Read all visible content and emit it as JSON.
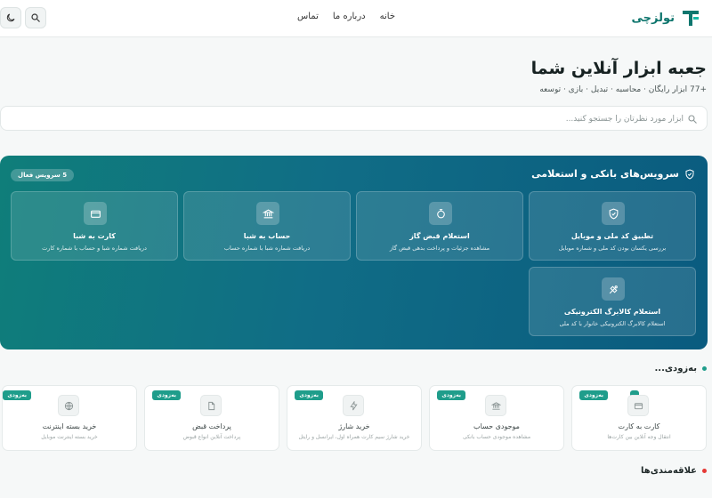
{
  "header": {
    "brand_name": "تولزچی",
    "nav": [
      "خانه",
      "درباره ما",
      "تماس"
    ]
  },
  "hero": {
    "title": "جعبه ابزار آنلاین شما",
    "subtitle": "+77 ابزار رایگان · محاسبه · تبدیل · بازی · توسعه",
    "search_placeholder": "ابزار مورد نظرتان را جستجو کنید..."
  },
  "bank": {
    "title": "سرویس‌های بانکی و استعلامی",
    "badge": "5 سرویس فعال",
    "services": [
      {
        "title": "تطبیق کد ملی و موبایل",
        "desc": "بررسی یکسان بودن کد ملی و شماره موبایل",
        "icon": "shield-check-icon"
      },
      {
        "title": "استعلام قبض گاز",
        "desc": "مشاهده جزئیات و پرداخت بدهی قبض گاز",
        "icon": "gas-flame-icon"
      },
      {
        "title": "حساب به شبا",
        "desc": "دریافت شماره شبا با شماره حساب",
        "icon": "bank-icon"
      },
      {
        "title": "کارت به شبا",
        "desc": "دریافت شماره شبا و حساب با شماره کارت",
        "icon": "credit-card-icon"
      },
      {
        "title": "استعلام کالابرگ الکترونیکی",
        "desc": "استعلام کالابرگ الکترونیکی خانوار با کد ملی",
        "icon": "tag-icon"
      }
    ]
  },
  "soon": {
    "title": "به‌زودی...",
    "badge": "به‌زودی",
    "items": [
      {
        "title": "کارت به کارت",
        "desc": "انتقال وجه آنلاین بین کارت‌ها",
        "icon": "card-icon"
      },
      {
        "title": "موجودی حساب",
        "desc": "مشاهده موجودی حساب بانکی",
        "icon": "bank-icon"
      },
      {
        "title": "خرید شارژ",
        "desc": "خرید شارژ سیم کارت همراه اول، ایرانسل و رایتل",
        "icon": "bolt-icon"
      },
      {
        "title": "پرداخت قبض",
        "desc": "پرداخت آنلاین انواع قبوض",
        "icon": "document-icon"
      },
      {
        "title": "خرید بسته اینترنت",
        "desc": "خرید بسته اینترنت موبایل",
        "icon": "globe-icon"
      }
    ]
  },
  "favorites": {
    "title": "علاقه‌مندی‌ها"
  },
  "colors": {
    "brand": "#0f766e",
    "accent_dot": "#1f9d8b",
    "favorites_dot": "#e53935"
  }
}
